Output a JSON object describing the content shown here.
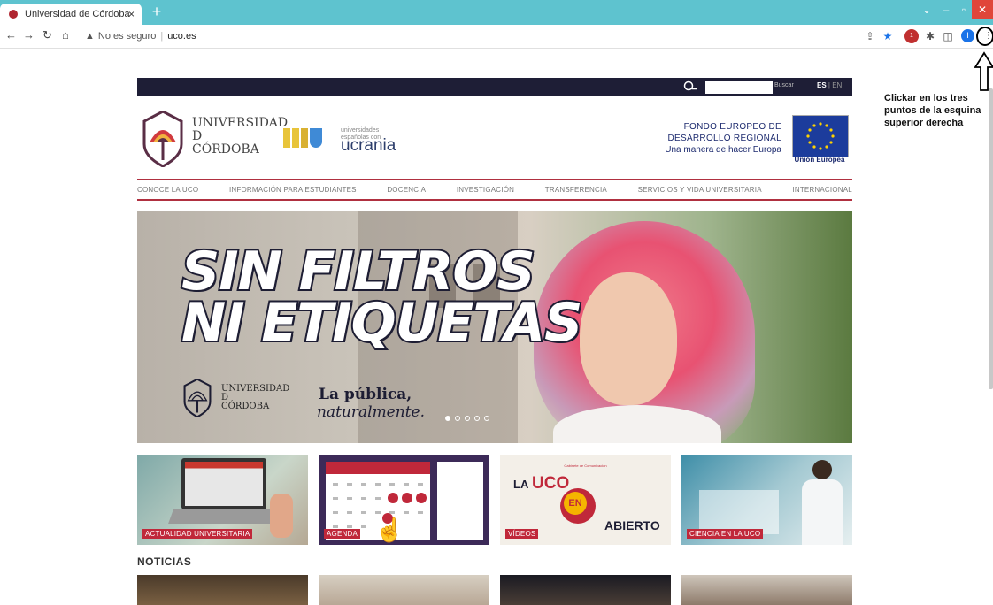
{
  "browser": {
    "tab_title": "Universidad de Córdoba",
    "tab_close": "×",
    "new_tab": "+",
    "security_label": "No es seguro",
    "url": "uco.es",
    "profile_initial": "I",
    "extension_badge": "1"
  },
  "instruction": {
    "text": "Clickar en los tres puntos de la esquina superior derecha"
  },
  "site": {
    "search_button": "Buscar",
    "lang_es": "ES",
    "lang_sep": "|",
    "lang_en": "EN",
    "university_line1": "UNIVERSIDAD",
    "university_line2": "D",
    "university_line3": "CÓRDOBA",
    "ucrania_small_1": "universidades",
    "ucrania_small_2": "españolas con",
    "ucrania_word": "ucrania",
    "fondo_line1": "FONDO EUROPEO DE",
    "fondo_line2": "DESARROLLO REGIONAL",
    "fondo_line3": "Una manera de hacer Europa",
    "eu_label": "Unión Europea",
    "menu": [
      "CONOCE LA UCO",
      "INFORMACIÓN PARA ESTUDIANTES",
      "DOCENCIA",
      "INVESTIGACIÓN",
      "TRANSFERENCIA",
      "SERVICIOS Y VIDA UNIVERSITARIA",
      "INTERNACIONAL"
    ],
    "hero": {
      "slogan_line1": "SIN FILTROS",
      "slogan_line2": "NI ETIQUETAS",
      "uni_line1": "UNIVERSIDAD",
      "uni_line2": "D",
      "uni_line3": "CÓRDOBA",
      "tagline1": "La pública,",
      "tagline2": "naturalmente."
    },
    "cards": [
      {
        "label": "ACTUALIDAD UNIVERSITARIA"
      },
      {
        "label": "AGENDA"
      },
      {
        "label": "VÍDEOS",
        "title_a": "LA",
        "title_b": "UCO",
        "title_c": "EN",
        "title_d": "ABIERTO",
        "header": "Gabinete de Comunicación"
      },
      {
        "label": "CIENCIA EN LA UCO"
      }
    ],
    "news_heading": "NOTICIAS"
  },
  "colors": {
    "tabstrip": "#5ec3cf",
    "topbar": "#1e1e36",
    "accent": "#c0283a",
    "eu_blue": "#1c3c9c"
  }
}
